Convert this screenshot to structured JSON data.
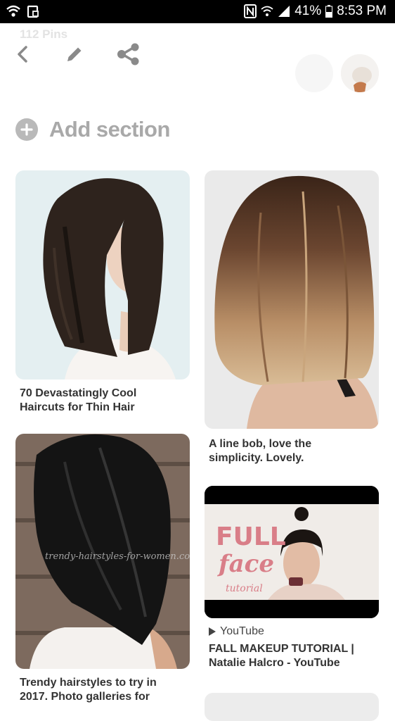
{
  "status_bar": {
    "battery": "41%",
    "time": "8:53 PM"
  },
  "header": {
    "pin_count": "112 Pins"
  },
  "add_section": {
    "label": "Add section"
  },
  "pins": [
    {
      "title_line1": "70 Devastatingly Cool",
      "title_line2": "Haircuts for Thin Hair"
    },
    {
      "title_line1": "A line bob, love the",
      "title_line2": "simplicity. Lovely."
    },
    {
      "title_line1": "Trendy hairstyles to try in",
      "title_line2": "2017. Photo galleries for",
      "watermark": "trendy-hairstyles-for-women.com"
    },
    {
      "source": "YouTube",
      "title_line1": "FALL MAKEUP TUTORIAL |",
      "title_line2": "Natalie Halcro - YouTube",
      "thumb_text_1": "FULL",
      "thumb_text_2": "face",
      "thumb_text_3": "tutorial"
    }
  ],
  "colors": {
    "status_bg": "#000000",
    "add_section_gray": "#a9a9a9",
    "title_text": "#333333",
    "makeup_pink": "#d97e88"
  }
}
